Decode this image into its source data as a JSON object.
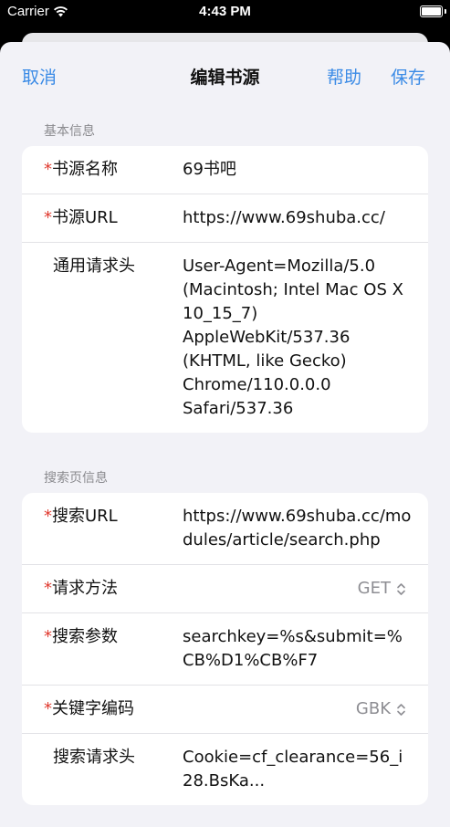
{
  "status_bar": {
    "carrier": "Carrier",
    "time": "4:43 PM"
  },
  "navbar": {
    "cancel": "取消",
    "title": "编辑书源",
    "help": "帮助",
    "save": "保存"
  },
  "basic_info": {
    "header": "基本信息",
    "rows": [
      {
        "required": "*",
        "label": "书源名称",
        "value": "69书吧"
      },
      {
        "required": "*",
        "label": "书源URL",
        "value": "https://www.69shuba.cc/"
      },
      {
        "required": "",
        "label": "通用请求头",
        "value": "User-Agent=Mozilla/5.0 (Macintosh; Intel Mac OS X 10_15_7) AppleWebKit/537.36 (KHTML, like Gecko) Chrome/110.0.0.0 Safari/537.36"
      }
    ]
  },
  "search_info": {
    "header": "搜索页信息",
    "rows": {
      "url": {
        "required": "*",
        "label": "搜索URL",
        "value": "https://www.69shuba.cc/modules/article/search.php"
      },
      "method": {
        "required": "*",
        "label": "请求方法",
        "value": "GET"
      },
      "params": {
        "required": "*",
        "label": "搜索参数",
        "value": "searchkey=%s&submit=%CB%D1%CB%F7"
      },
      "encoding": {
        "required": "*",
        "label": "关键字编码",
        "value": "GBK"
      },
      "headers": {
        "required": "",
        "label": "搜索请求头",
        "value": "Cookie=cf_clearance=56_i28.BsKa..."
      }
    }
  }
}
